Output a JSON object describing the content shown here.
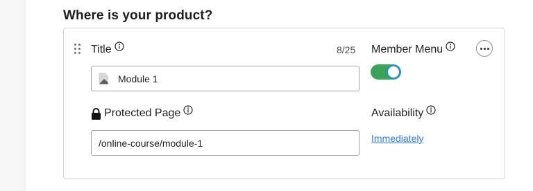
{
  "section": {
    "title": "Where is your product?"
  },
  "fields": {
    "title": {
      "label": "Title",
      "counter": "8/25",
      "value": "Module 1"
    },
    "member_menu": {
      "label": "Member Menu",
      "enabled": true
    },
    "protected_page": {
      "label": "Protected Page",
      "value": "/online-course/module-1"
    },
    "availability": {
      "label": "Availability",
      "value": "Immediately"
    }
  },
  "icons": {
    "drag": "drag-handle-icon",
    "info": "info-icon",
    "page": "page-icon",
    "lock": "lock-icon",
    "more": "more-horizontal-icon"
  },
  "colors": {
    "toggle_on": "#3aa35a",
    "toggle_knob_ring": "#2f8ae0",
    "link": "#2f78d8"
  }
}
